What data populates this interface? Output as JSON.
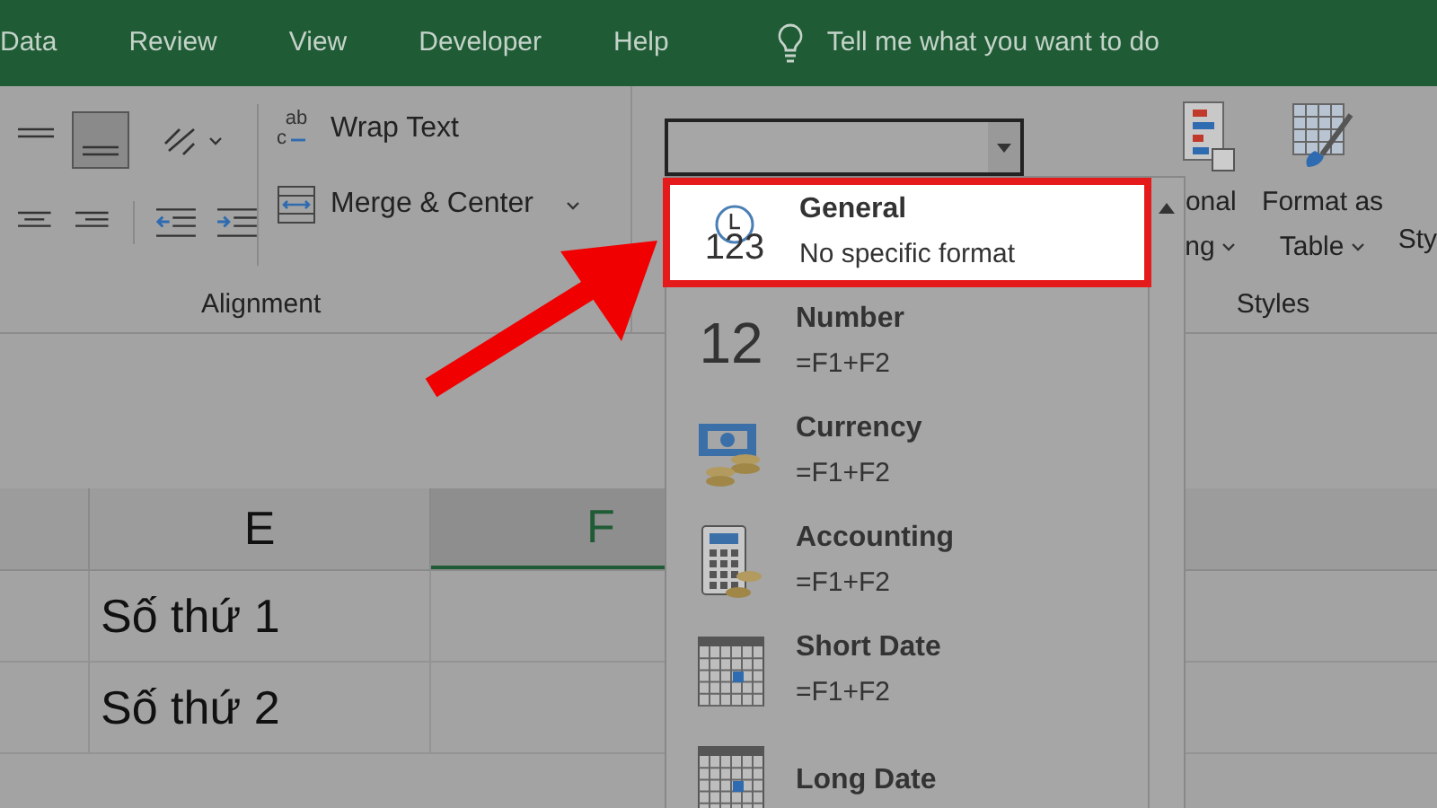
{
  "ribbon_tabs": [
    {
      "label": "Data"
    },
    {
      "label": "Review"
    },
    {
      "label": "View"
    },
    {
      "label": "Developer"
    },
    {
      "label": "Help"
    }
  ],
  "tell_me": {
    "text": "Tell me what you want to do"
  },
  "alignment_group": {
    "label": "Alignment",
    "wrap_text": "Wrap Text",
    "wrap_icon_text": [
      "ab",
      "c"
    ],
    "merge_center": "Merge & Center",
    "bottom_align_selected": true
  },
  "number_format_dropdown": {
    "items": [
      {
        "kind": "general",
        "icon_text": "123",
        "name": "General",
        "example": "No specific format",
        "selected": true
      },
      {
        "kind": "number",
        "icon_text": "12",
        "name": "Number",
        "example": "=F1+F2",
        "selected": false
      },
      {
        "kind": "currency",
        "name": "Currency",
        "example": "=F1+F2",
        "selected": false
      },
      {
        "kind": "accounting",
        "name": "Accounting",
        "example": "=F1+F2",
        "selected": false
      },
      {
        "kind": "date",
        "name": "Short Date",
        "example": "=F1+F2",
        "selected": false
      },
      {
        "kind": "date",
        "name": "Long Date",
        "selected": false
      }
    ]
  },
  "styles_group": {
    "label": "Styles",
    "conditional_formatting": [
      "onal",
      "ng"
    ],
    "format_as_table": [
      "Format as",
      "Table"
    ],
    "cell_styles": "Sty"
  },
  "sheet": {
    "columns": [
      {
        "label": "E",
        "selected": false
      },
      {
        "label": "F",
        "selected": true
      }
    ],
    "rows": [
      {
        "cell": "Số thứ 1"
      },
      {
        "cell": "Số thứ 2"
      }
    ]
  }
}
